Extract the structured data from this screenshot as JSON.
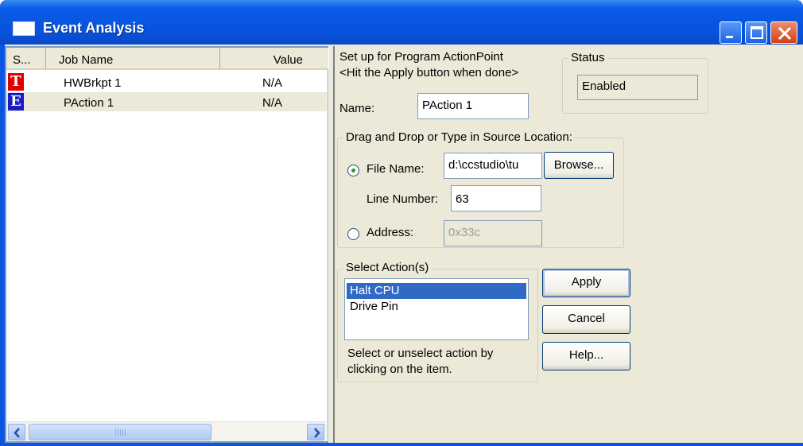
{
  "window": {
    "title": "Event Analysis"
  },
  "list": {
    "columns": [
      "S...",
      "Job Name",
      "Value"
    ],
    "rows": [
      {
        "status_letter": "T",
        "job_name": "HWBrkpt 1",
        "value": "N/A",
        "badge_color": "#e00000"
      },
      {
        "status_letter": "E",
        "job_name": "PAction 1",
        "value": "N/A",
        "badge_color": "#1a1acb"
      }
    ]
  },
  "scrollbar": {
    "left_arrow": "<",
    "right_arrow": ">"
  },
  "setup": {
    "line1": "Set up for Program ActionPoint",
    "line2": "<Hit the Apply button when done>",
    "name_label": "Name:",
    "name_value": "PAction 1"
  },
  "status": {
    "group_label": "Status",
    "value": "Enabled"
  },
  "source": {
    "group_label": "Drag and Drop or Type in Source Location:",
    "file_name_label": "File Name:",
    "file_name_value": "d:\\ccstudio\\tu",
    "browse_label": "Browse...",
    "line_number_label": "Line Number:",
    "line_number_value": "63",
    "address_label": "Address:",
    "address_value": "0x33c",
    "selected_option": "File Name"
  },
  "actions": {
    "group_label": "Select Action(s)",
    "items": [
      {
        "label": "Halt CPU",
        "selected": true
      },
      {
        "label": "Drive Pin",
        "selected": false
      }
    ],
    "hint_line1": "Select or unselect action by",
    "hint_line2": "clicking on the item."
  },
  "buttons": {
    "apply": "Apply",
    "cancel": "Cancel",
    "help": "Help..."
  },
  "colors": {
    "titlebar": "#0a55e2",
    "selection": "#316ac5",
    "dialog_bg": "#ece9d8"
  }
}
